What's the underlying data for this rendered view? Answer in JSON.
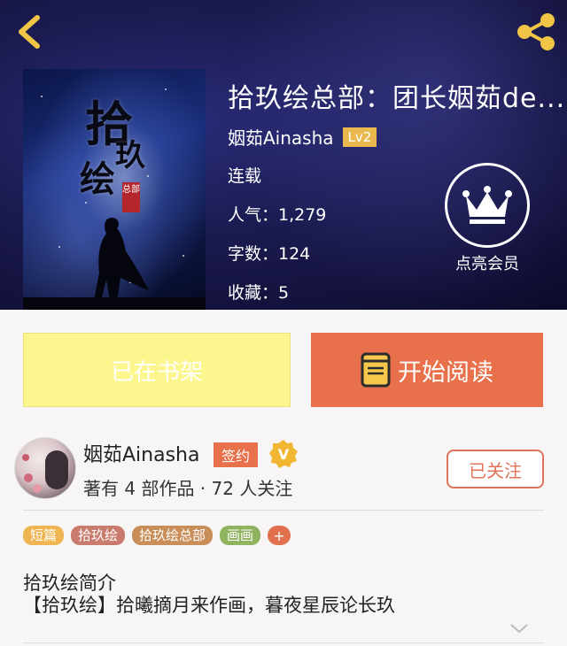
{
  "book": {
    "title": "拾玖绘总部：团长姻茹de...",
    "author": "姻茹Ainasha",
    "level": "Lv2",
    "status": "连载",
    "popularity": "人气：1,279",
    "word_count": "字数：124",
    "favorites": "收藏：5",
    "cover": {
      "char_1": "拾",
      "char_2": "玖",
      "char_3": "绘",
      "seal": "总部"
    }
  },
  "member": {
    "label": "点亮会员"
  },
  "actions": {
    "shelf_label": "已在书架",
    "read_label": "开始阅读"
  },
  "author_card": {
    "name": "姻茹Ainasha",
    "sign_badge": "签约",
    "v_badge": "V",
    "stats": "著有 4 部作品 · 72 人关注",
    "follow_label": "已关注"
  },
  "tags": [
    {
      "label": "短篇",
      "color": "#efb552"
    },
    {
      "label": "拾玖绘",
      "color": "#c97b6d"
    },
    {
      "label": "拾玖绘总部",
      "color": "#c98d5a"
    },
    {
      "label": "画画",
      "color": "#8fb35e"
    }
  ],
  "tag_more": "+",
  "intro": {
    "title": "拾玖绘简介",
    "body": "【拾玖绘】拾曦摘月来作画，暮夜星辰论长玖"
  },
  "colors": {
    "accent": "#e8704a",
    "shelf_bg": "#fcf68e",
    "badge_gold": "#e9b84e"
  }
}
